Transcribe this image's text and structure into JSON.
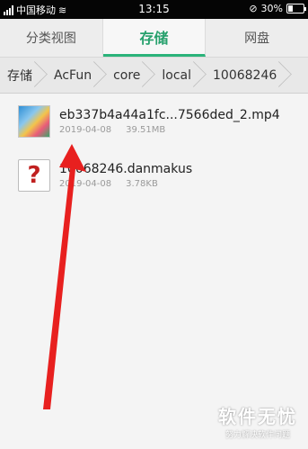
{
  "status_bar": {
    "carrier": "中国移动",
    "time": "13:15",
    "battery": "30%",
    "battery_level": 0.3
  },
  "tabs": [
    {
      "label": "分类视图",
      "active": false
    },
    {
      "label": "存储",
      "active": true
    },
    {
      "label": "网盘",
      "active": false
    }
  ],
  "breadcrumb": [
    "存储",
    "AcFun",
    "core",
    "local",
    "10068246"
  ],
  "files": [
    {
      "name": "eb337b4a44a1fc...7566ded_2.mp4",
      "date": "2019-04-08",
      "size": "39.51MB",
      "icon": "video-thumbnail"
    },
    {
      "name": "10068246.danmakus",
      "date": "2019-04-08",
      "size": "3.78KB",
      "icon": "unknown-file-icon"
    }
  ],
  "watermark": {
    "main": "软件无忧",
    "sub": "努力解决软件问题"
  },
  "colors": {
    "accent": "#27a16d",
    "arrow": "#e8201f"
  }
}
